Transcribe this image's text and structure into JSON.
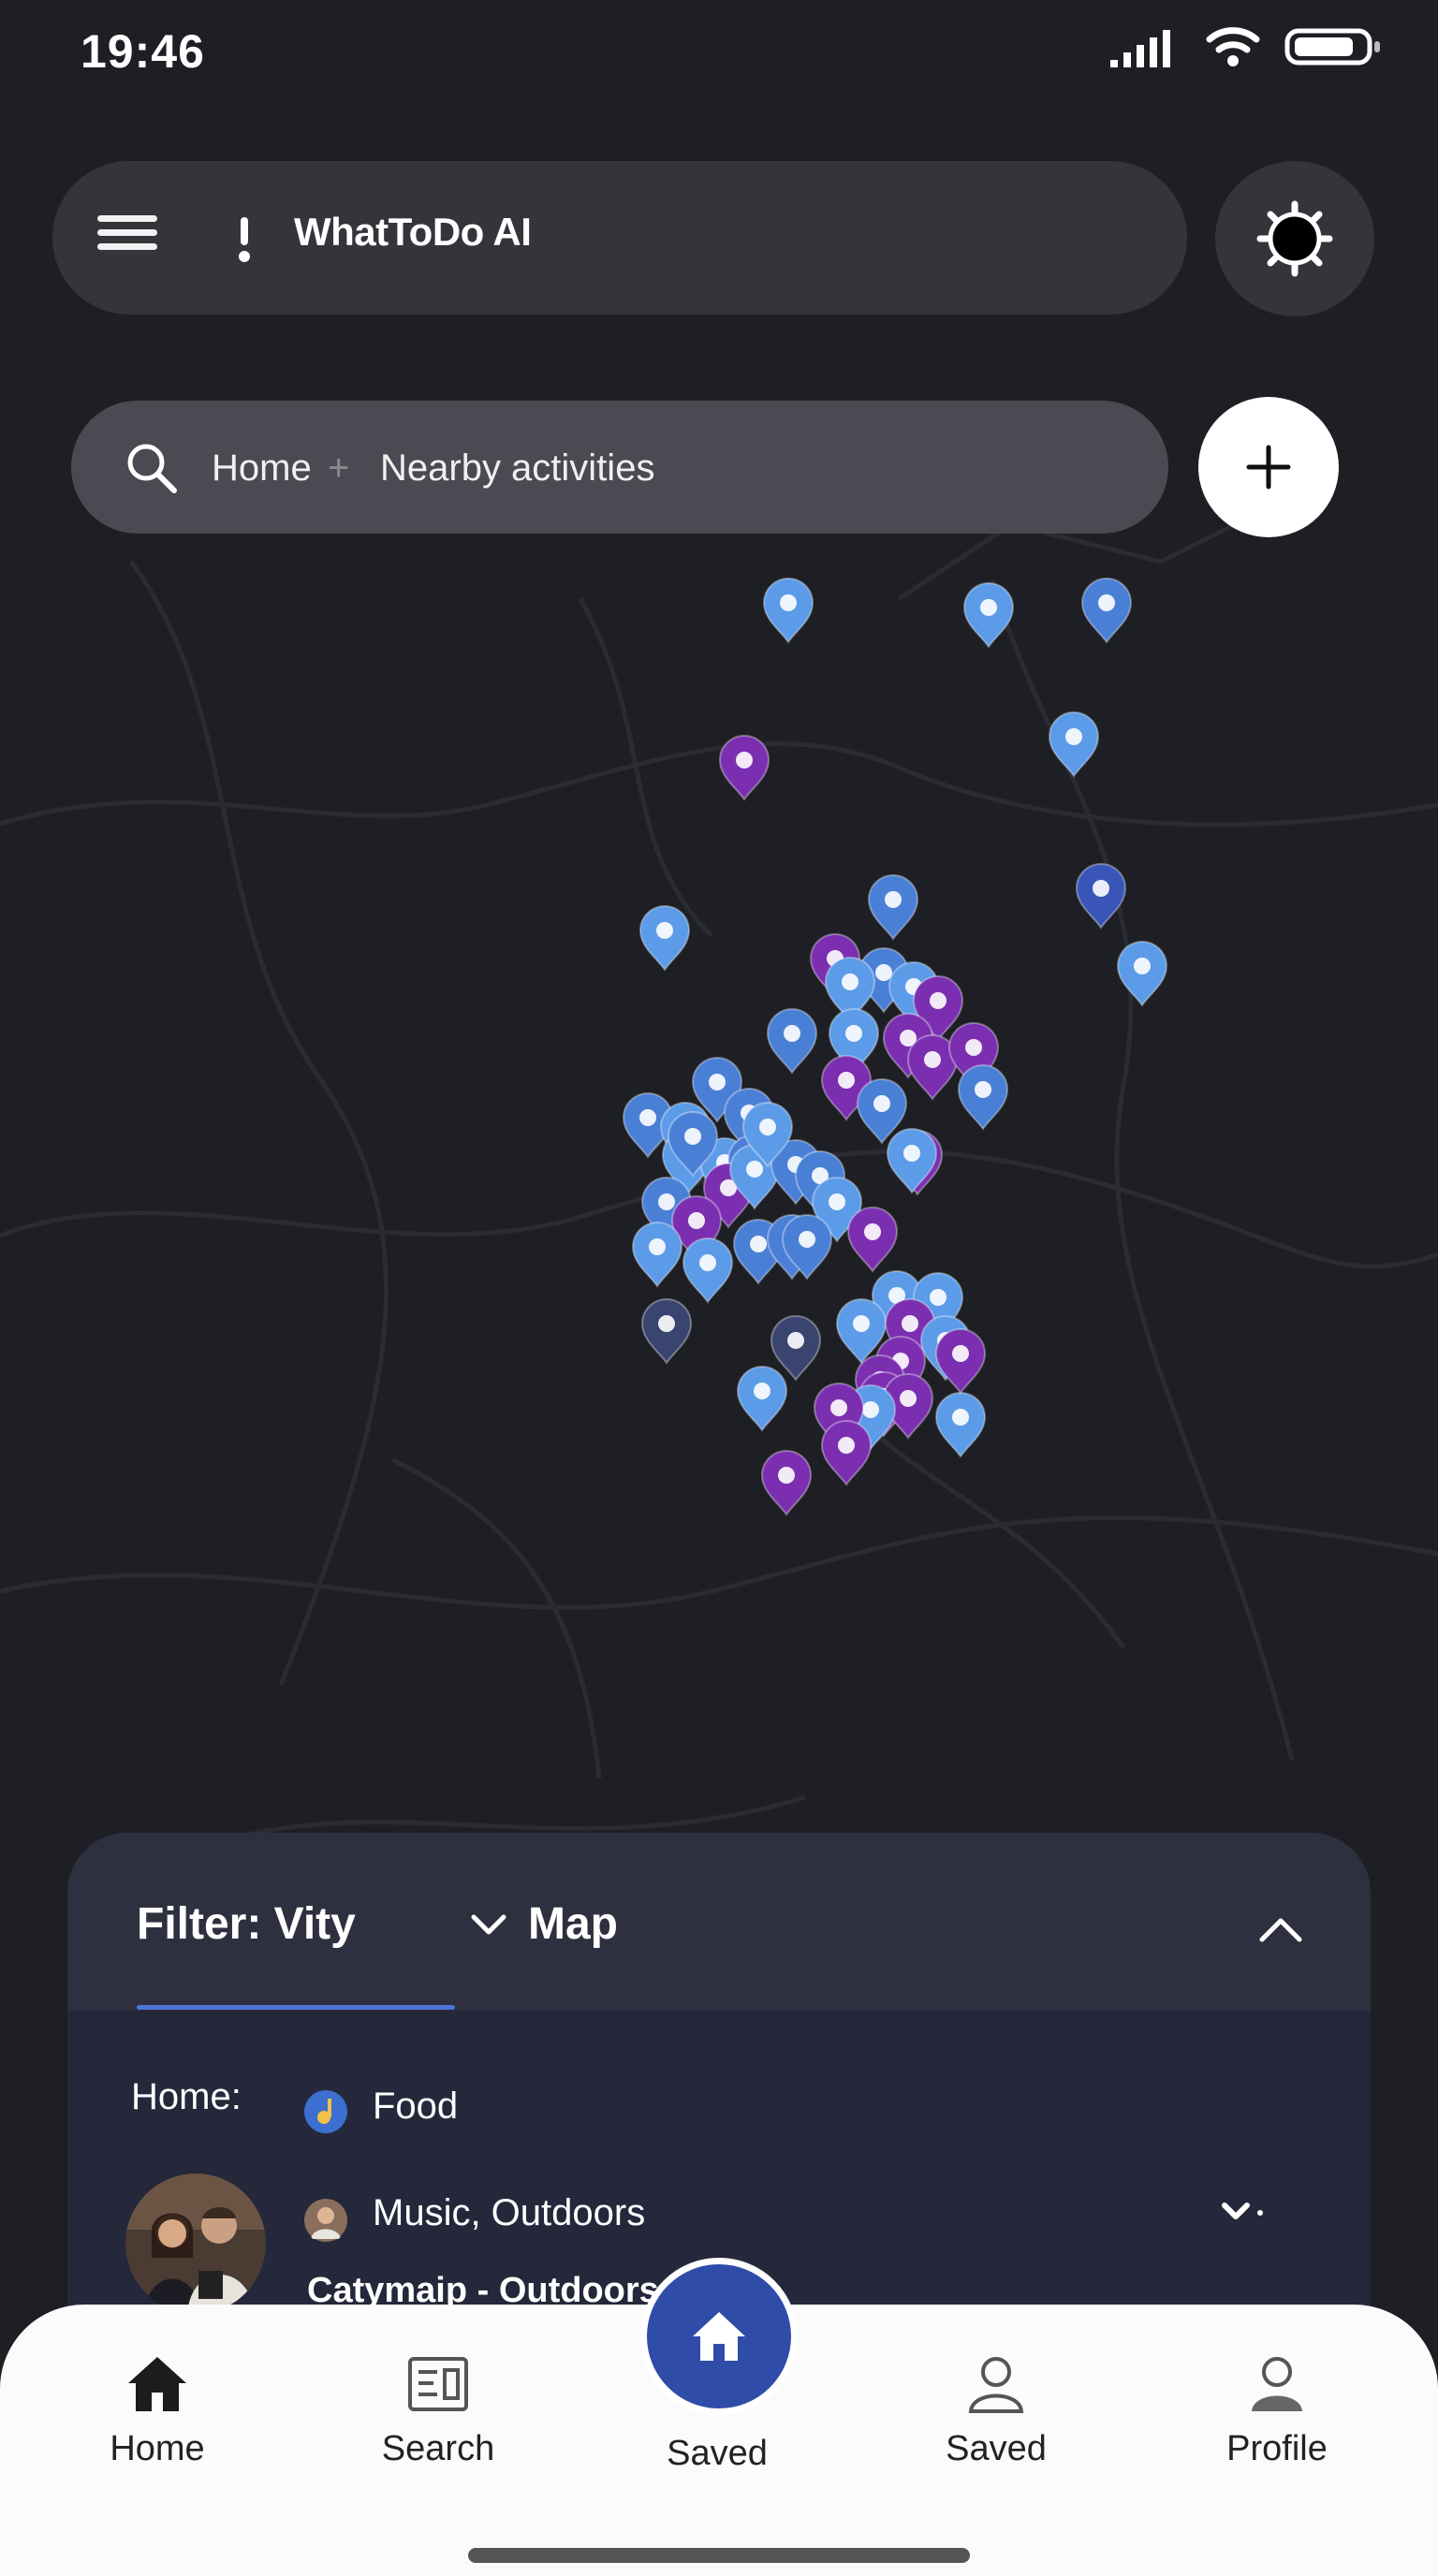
{
  "status": {
    "time": "19:46"
  },
  "header": {
    "title": "WhatToDo AI"
  },
  "search": {
    "crumb_home": "Home",
    "crumb_separator": "+",
    "crumb_current": "Nearby activities"
  },
  "sheet": {
    "tab_filter": "Filter: Vity",
    "tab_map": "Map",
    "home_label": "Home:",
    "food_label": "Food",
    "music_label": "Music, Outdoors",
    "row_subtitle": "Catymaip - Outdoors"
  },
  "nav": {
    "items": [
      {
        "label": "Home",
        "icon": "home-icon"
      },
      {
        "label": "Search",
        "icon": "search-list-icon"
      },
      {
        "label": "Saved",
        "icon": "home-center-icon"
      },
      {
        "label": "Saved",
        "icon": "person-outline-icon"
      },
      {
        "label": "Profile",
        "icon": "person-filled-icon"
      }
    ]
  },
  "colors": {
    "background": "#1e1f24",
    "pin_blue": "#4a7fd6",
    "pin_light_blue": "#5b9be8",
    "pin_purple": "#7b2fb0",
    "accent": "#2f4da8"
  }
}
